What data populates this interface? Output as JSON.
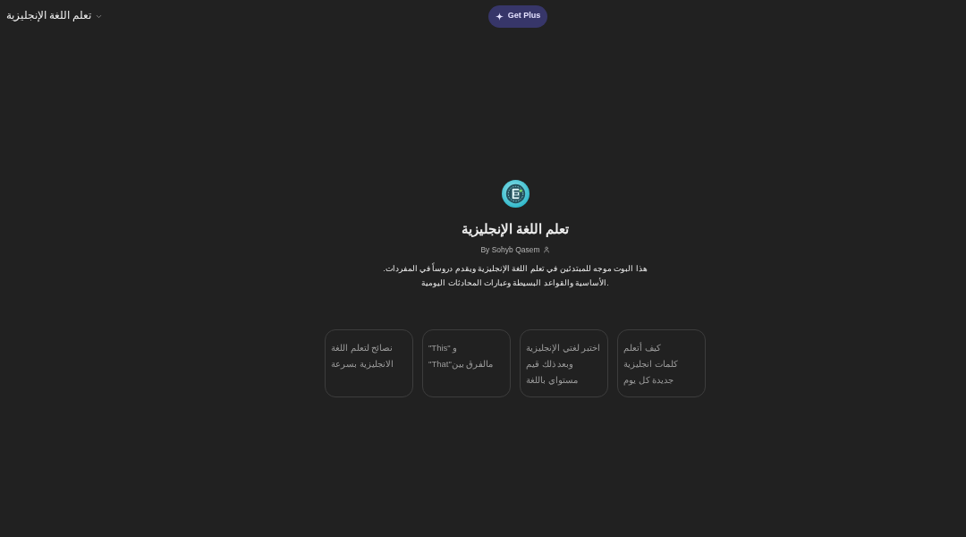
{
  "header": {
    "title": "تعلم اللغة الإنجليزية",
    "upgrade_button": "Get Plus"
  },
  "gpt": {
    "name": "تعلم اللغة الإنجليزية",
    "author": "By Sohyb Qasem",
    "description_lines": [
      "هذا البوت موجه للمبتدئين في تعلم اللغة الإنجليزية ويقدم دروساً في المفردات.",
      ".الأساسية والقواعد البسيطة وعبارات المحادثات اليومية"
    ]
  },
  "conversation_starters": [
    {
      "lines": [
        "كيف أتعلم",
        "كلمات انجليزية",
        "جديدة كل يوم"
      ]
    },
    {
      "lines": [
        "اختبر لغتي الإنجليزية",
        "وبعد ذلك قيم",
        "مستواي باللغة"
      ]
    },
    {
      "lines": [
        "\"This\" و",
        "مالفرق بين\"That\""
      ]
    },
    {
      "lines": [
        "نصائح لتعلم اللغة",
        "الانجليزية بسرعة"
      ]
    }
  ]
}
